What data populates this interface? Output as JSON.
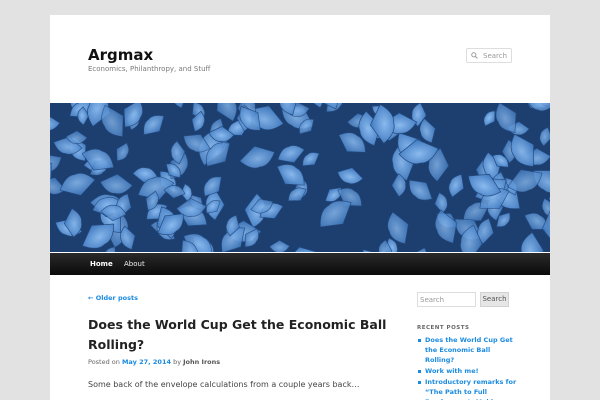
{
  "site": {
    "title": "Argmax",
    "description": "Economics, Philanthropy, and Stuff"
  },
  "header_search": {
    "placeholder": "Search",
    "icon": "search-icon"
  },
  "banner": {
    "description_icon": "leaf-banner-image",
    "color": "#2f5f9a"
  },
  "nav": {
    "items": [
      {
        "label": "Home",
        "active": true
      },
      {
        "label": "About",
        "active": false
      }
    ]
  },
  "main": {
    "older_posts": "← Older posts",
    "post": {
      "title": "Does the World Cup Get the Economic Ball Rolling?",
      "meta_prefix": "Posted on",
      "date": "May 27, 2014",
      "by": "by",
      "author": "John Irons",
      "excerpt": "Some back of the envelope calculations from a couple years back…"
    }
  },
  "sidebar": {
    "search_placeholder": "Search",
    "search_button": "Search",
    "recent_heading": "RECENT POSTS",
    "recent_posts": [
      "Does the World Cup Get the Economic Ball Rolling?",
      "Work with me!",
      "Introductory remarks for “The Path to Full Employment: Making Jobs a"
    ]
  },
  "colors": {
    "link": "#1b8be0",
    "nav_bg": "#111111",
    "page_bg": "#e2e2e2"
  }
}
